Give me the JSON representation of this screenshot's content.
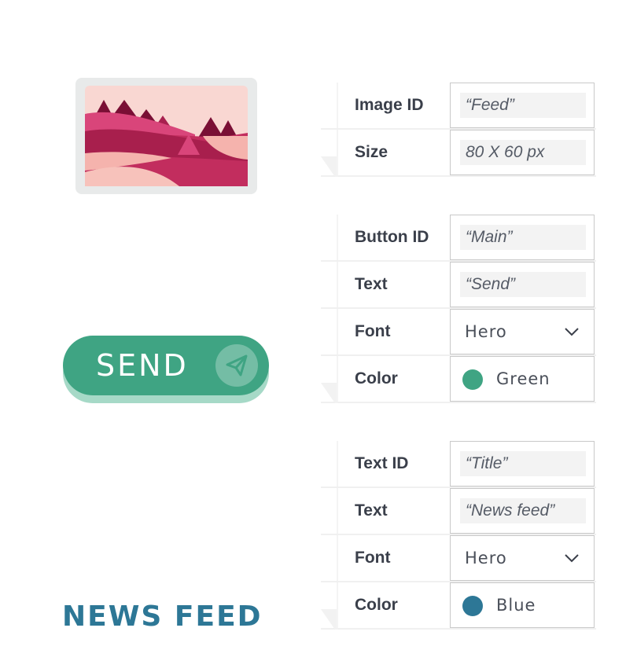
{
  "image_panel": {
    "rows": [
      {
        "key": "Image ID",
        "value": "“Feed”"
      },
      {
        "key": "Size",
        "value": "80 X 60 px"
      }
    ]
  },
  "button_panel": {
    "rows": [
      {
        "key": "Button ID",
        "value": "“Main”"
      },
      {
        "key": "Text",
        "value": "“Send”"
      },
      {
        "key": "Font",
        "value": "Hero"
      },
      {
        "key": "Color",
        "value": "Green"
      }
    ],
    "color_hex": "#3fa483"
  },
  "text_panel": {
    "rows": [
      {
        "key": "Text ID",
        "value": "“Title”"
      },
      {
        "key": "Text",
        "value": "“News feed”"
      },
      {
        "key": "Font",
        "value": "Hero"
      },
      {
        "key": "Color",
        "value": "Blue"
      }
    ],
    "color_hex": "#2d7796"
  },
  "previews": {
    "send_button_label": "SEND",
    "news_title": "NEWS FEED",
    "plane_icon": "paper-plane-icon",
    "image_icon": "landscape-image"
  }
}
